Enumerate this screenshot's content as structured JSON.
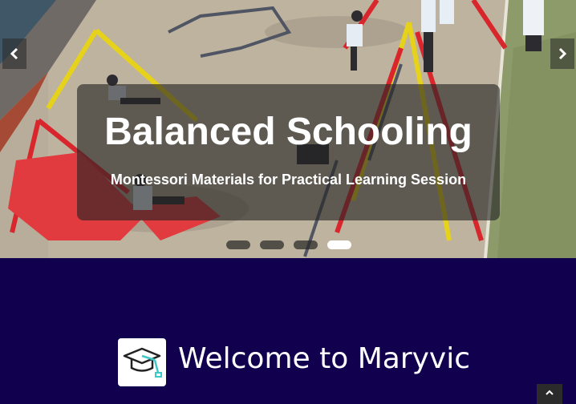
{
  "slider": {
    "title": "Balanced Schooling",
    "subtitle": "Montessori Materials for Practical Learning Session",
    "prev_icon": "chevron-left-icon",
    "next_icon": "chevron-right-icon",
    "indicator_count": 4,
    "active_index": 3
  },
  "welcome": {
    "title": "Welcome to Maryvic",
    "logo_icon": "graduation-cap-icon"
  },
  "back_to_top_icon": "chevron-up-icon",
  "colors": {
    "page_background": "#10004d",
    "caption_overlay": "#232323",
    "text": "#ffffff"
  }
}
